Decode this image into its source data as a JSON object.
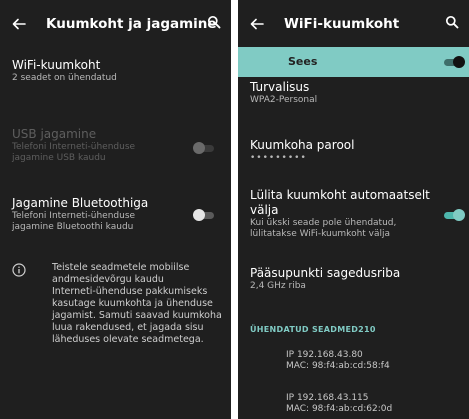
{
  "left": {
    "title": "Kuumkoht ja jagamine",
    "wifi": {
      "title": "WiFi-kuumkoht",
      "subtitle": "2 seadet on ühendatud"
    },
    "usb": {
      "title": "USB jagamine",
      "subtitle_1": "Telefoni Interneti-ühenduse",
      "subtitle_2": "jagamine USB kaudu",
      "enabled": false
    },
    "bluetooth": {
      "title": "Jagamine Bluetoothiga",
      "subtitle_1": "Telefoni Interneti-ühenduse",
      "subtitle_2": "jagamine Bluetoothi kaudu",
      "enabled": false
    },
    "info": [
      "Teistele seadmetele mobiilse",
      "andmesidevõrgu kaudu",
      "Interneti-ühenduse pakkumiseks",
      "kasutage kuumkohta ja ühenduse",
      "jagamist. Samuti saavad kuumkoha",
      "luua rakendused, et jagada sisu",
      "läheduses olevate seadmetega."
    ]
  },
  "right": {
    "title": "WiFi-kuumkoht",
    "master": {
      "label": "Sees",
      "enabled": true
    },
    "security": {
      "title": "Turvalisus",
      "value": "WPA2-Personal"
    },
    "password": {
      "title": "Kuumkoha parool",
      "value": "•••••••••"
    },
    "auto_off": {
      "title_1": "Lülita kuumkoht automaatselt",
      "title_2": "välja",
      "subtitle_1": "Kui ükski seade pole ühendatud,",
      "subtitle_2": "lülitatakse WiFi-kuumkoht välja",
      "enabled": true
    },
    "band": {
      "title": "Pääsupunkti sagedusriba",
      "value": "2,4 GHz riba"
    },
    "connected_header": "ÜHENDATUD SEADMED210",
    "devices": [
      {
        "ip": "IP 192.168.43.80",
        "mac": "MAC: 98:f4:ab:cd:58:f4"
      },
      {
        "ip": "IP 192.168.43.115",
        "mac": "MAC: 98:f4:ab:cd:62:0d"
      }
    ]
  },
  "colors": {
    "background": "#1f1f1f",
    "accent": "#80cbc4",
    "switch_on_track": "#4db6ac",
    "switch_on_thumb": "#80cbc4",
    "switch_off_track": "#5a5a5a",
    "switch_off_thumb": "#e6e6e6"
  },
  "icons": [
    "back-arrow-icon",
    "search-icon",
    "info-icon"
  ]
}
